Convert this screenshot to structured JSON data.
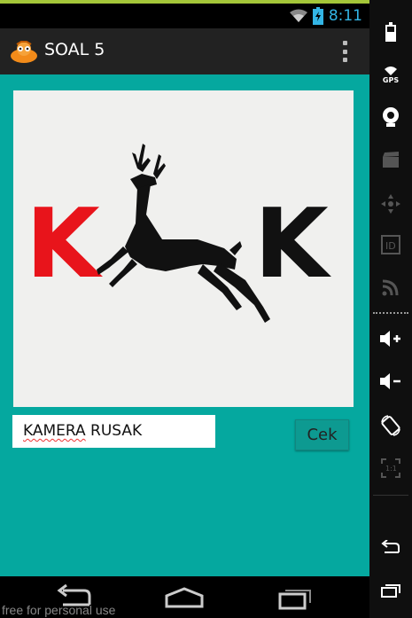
{
  "status_bar": {
    "time": "8:11"
  },
  "action_bar": {
    "title": "SOAL 5"
  },
  "content": {
    "image_alt_letters": {
      "left": "K",
      "right": "K"
    },
    "answer_value": "KAMERA RUSAK",
    "answer_underlined_word": "KAMERA",
    "answer_rest": " RUSAK",
    "check_button_label": "Cek"
  },
  "sidebar": {
    "gps_label": "GPS"
  },
  "watermark": "free for personal use",
  "colors": {
    "content_bg": "#05a89f",
    "action_bar_bg": "#222222",
    "clock": "#33b5e5",
    "logo_red": "#e8141b"
  }
}
